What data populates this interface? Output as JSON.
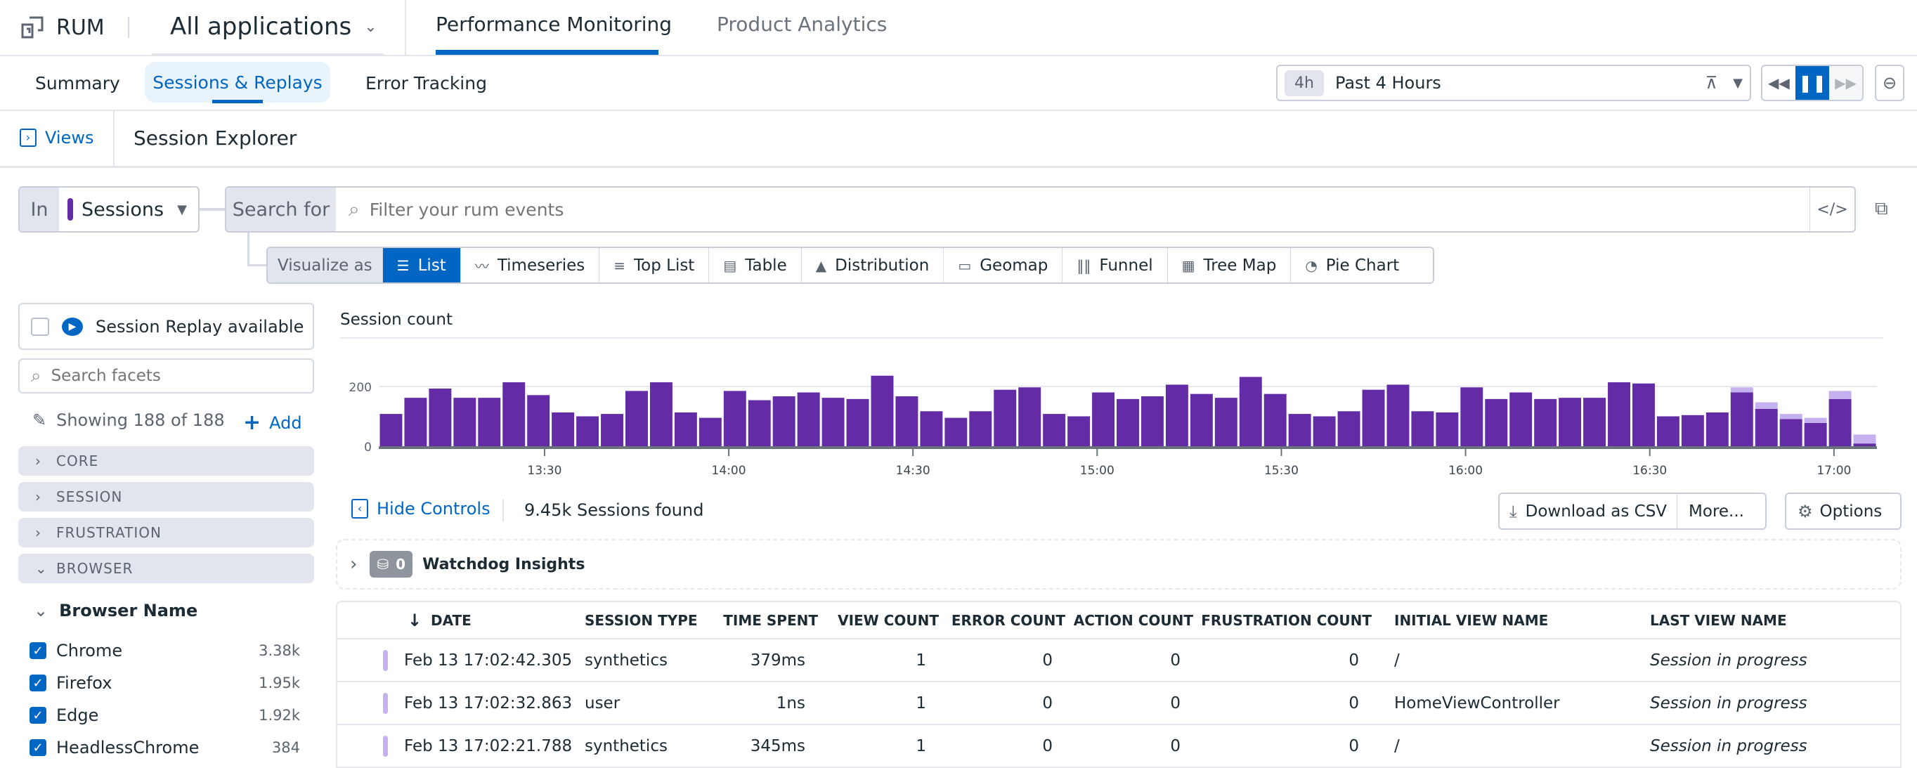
{
  "topnav": {
    "product": "RUM",
    "app_selector": "All applications",
    "tabs": [
      {
        "label": "Performance Monitoring",
        "active": true
      },
      {
        "label": "Product Analytics",
        "active": false
      }
    ]
  },
  "subnav": {
    "tabs": [
      {
        "label": "Summary"
      },
      {
        "label": "Sessions & Replays",
        "active": true
      },
      {
        "label": "Error Tracking"
      }
    ],
    "time_badge": "4h",
    "time_label": "Past 4 Hours"
  },
  "views_bar": {
    "views_label": "Views",
    "title": "Session Explorer"
  },
  "query": {
    "in_label": "In",
    "source": "Sessions",
    "search_label": "Search for",
    "search_placeholder": "Filter your rum events"
  },
  "visualize": {
    "label": "Visualize as",
    "options": [
      "List",
      "Timeseries",
      "Top List",
      "Table",
      "Distribution",
      "Geomap",
      "Funnel",
      "Tree Map",
      "Pie Chart"
    ],
    "selected": "List"
  },
  "facets": {
    "replay_label": "Session Replay available",
    "search_placeholder": "Search facets",
    "showing": "Showing 188 of 188",
    "add_label": "Add",
    "groups": [
      "CORE",
      "SESSION",
      "FRUSTRATION",
      "BROWSER"
    ],
    "browser_name_title": "Browser Name",
    "browsers": [
      {
        "name": "Chrome",
        "count": "3.38k"
      },
      {
        "name": "Firefox",
        "count": "1.95k"
      },
      {
        "name": "Edge",
        "count": "1.92k"
      },
      {
        "name": "HeadlessChrome",
        "count": "384"
      }
    ]
  },
  "chart_data": {
    "type": "bar",
    "title": "Session count",
    "stacked": true,
    "y_ticks": [
      "0",
      "200"
    ],
    "ylim": [
      0,
      250
    ],
    "x_ticks": [
      "13:30",
      "14:00",
      "14:30",
      "15:00",
      "15:30",
      "16:00",
      "16:30",
      "17:00"
    ],
    "xlim_minutes_from_1300": [
      3,
      247
    ],
    "series": [
      {
        "name": "dark",
        "color": "#632ca6",
        "values": [
          108,
          162,
          193,
          162,
          162,
          214,
          171,
          113,
          100,
          108,
          185,
          214,
          113,
          95,
          185,
          154,
          167,
          180,
          162,
          158,
          236,
          167,
          117,
          95,
          117,
          189,
          197,
          108,
          100,
          180,
          158,
          167,
          206,
          175,
          162,
          232,
          175,
          108,
          100,
          117,
          189,
          206,
          117,
          113,
          197,
          158,
          180,
          158,
          162,
          162,
          214,
          210,
          100,
          104,
          113,
          180,
          125,
          91,
          78,
          158,
          9
        ]
      },
      {
        "name": "light",
        "color": "#c5b1ef",
        "values": [
          0,
          0,
          0,
          0,
          0,
          0,
          0,
          0,
          0,
          0,
          0,
          0,
          0,
          0,
          0,
          0,
          0,
          0,
          0,
          0,
          0,
          0,
          0,
          0,
          0,
          0,
          0,
          0,
          0,
          0,
          0,
          0,
          0,
          0,
          0,
          0,
          0,
          0,
          0,
          0,
          0,
          0,
          0,
          0,
          0,
          0,
          0,
          0,
          0,
          0,
          0,
          0,
          0,
          0,
          0,
          17,
          22,
          17,
          17,
          27,
          30
        ]
      }
    ]
  },
  "results": {
    "hide_controls": "Hide Controls",
    "found": "9.45k Sessions found",
    "download": "Download as CSV",
    "more": "More...",
    "options": "Options",
    "watchdog_count": "0",
    "watchdog_label": "Watchdog Insights",
    "columns": [
      "DATE",
      "SESSION TYPE",
      "TIME SPENT",
      "VIEW COUNT",
      "ERROR COUNT",
      "ACTION COUNT",
      "FRUSTRATION COUNT",
      "INITIAL VIEW NAME",
      "LAST VIEW NAME"
    ],
    "rows": [
      [
        "Feb 13 17:02:42.305",
        "synthetics",
        "379ms",
        "1",
        "0",
        "0",
        "0",
        "/",
        "Session in progress"
      ],
      [
        "Feb 13 17:02:32.863",
        "user",
        "1ns",
        "1",
        "0",
        "0",
        "0",
        "HomeViewController",
        "Session in progress"
      ],
      [
        "Feb 13 17:02:21.788",
        "synthetics",
        "345ms",
        "1",
        "0",
        "0",
        "0",
        "/",
        "Session in progress"
      ]
    ]
  },
  "colors": {
    "accent": "#0066c4",
    "purple": "#632ca6",
    "light_purple": "#c5b1ef"
  }
}
